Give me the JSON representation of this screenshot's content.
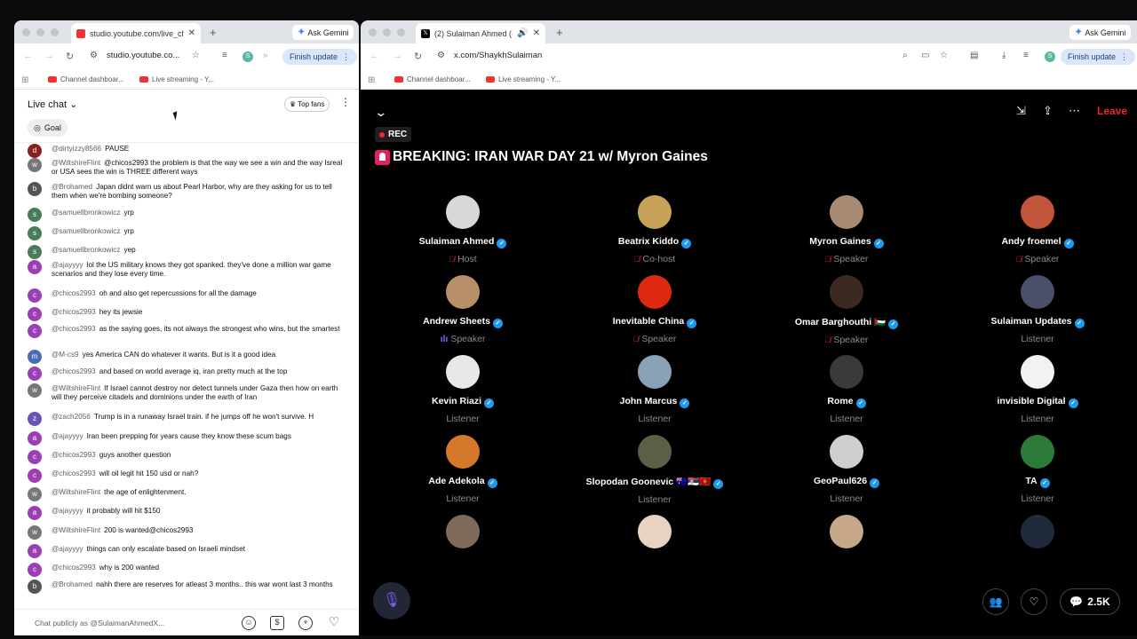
{
  "left_browser": {
    "tab_title": "studio.youtube.com/live_cha",
    "ask_gemini": "Ask Gemini",
    "url": "studio.youtube.co...",
    "finish_update": "Finish update",
    "bookmarks": [
      "Channel dashboar...",
      "Live streaming - Y..."
    ]
  },
  "youtube": {
    "live_chat": "Live chat",
    "top_fans": "Top fans",
    "goal": "Goal",
    "messages": [
      {
        "author": "@dirtyizzy8566",
        "text": "PAUSE",
        "color": "#8b1f1f"
      },
      {
        "author": "@WiltshireFlint",
        "text": "@chicos2993 the problem is that the way we see a win and the way Isreal or USA sees the win is THREE different ways",
        "color": "#777777"
      },
      {
        "author": "@Brohamed",
        "text": "Japan didnt warn us about Pearl Harbor, why are they asking for us to tell them when we're bombing someone?",
        "color": "#555555"
      },
      {
        "author": "@samuellbronkowicz",
        "text": "yrp",
        "color": "#4a7c59"
      },
      {
        "author": "@samuellbronkowicz",
        "text": "yrp",
        "color": "#4a7c59"
      },
      {
        "author": "@samuellbronkowicz",
        "text": "yep",
        "color": "#4a7c59"
      },
      {
        "author": "@ajayyyy",
        "text": "lol the US military knows they got spanked. they've done a million war game scenarios and they lose every time.",
        "color": "#9c3fb5"
      },
      {
        "author": "@chicos2993",
        "text": "oh and also get repercussions for all the damage",
        "color": "#9c3fb5"
      },
      {
        "author": "@chicos2993",
        "text": "hey its jewsie",
        "color": "#9c3fb5"
      },
      {
        "author": "@chicos2993",
        "text": "as the saying goes, its not always the strongest who wins, but the smartest",
        "color": "#9c3fb5"
      },
      {
        "author": "@M-cs9",
        "text": "yes America CAN do whatever it wants. But is it a good idea",
        "color": "#4a6bb5"
      },
      {
        "author": "@chicos2993",
        "text": "and based on world average iq, iran pretty much at the top",
        "color": "#9c3fb5"
      },
      {
        "author": "@WiltshireFlint",
        "text": "If Israel cannot destroy nor detect tunnels under Gaza then how on earth will they perceive citadels and dominions under the earth of Iran",
        "color": "#777777"
      },
      {
        "author": "@zach2056",
        "text": "Trump is in a runaway Israel train. if he jumps off he won't survive. H",
        "color": "#6a55b5"
      },
      {
        "author": "@ajayyyy",
        "text": "Iran been prepping for years cause they know these scum bags",
        "color": "#9c3fb5"
      },
      {
        "author": "@chicos2993",
        "text": "guys another question",
        "color": "#9c3fb5"
      },
      {
        "author": "@chicos2993",
        "text": "will oil legit hit 150 usd or nah?",
        "color": "#9c3fb5"
      },
      {
        "author": "@WiltshireFlint",
        "text": "the age of enlightenment.",
        "color": "#777777"
      },
      {
        "author": "@ajayyyy",
        "text": "it probably will hit $150",
        "color": "#9c3fb5"
      },
      {
        "author": "@WiltshireFlint",
        "text": "200 is wanted@chicos2993",
        "color": "#777777"
      },
      {
        "author": "@ajayyyy",
        "text": "things can only escalate based on Israeli mindset",
        "color": "#9c3fb5"
      },
      {
        "author": "@chicos2993",
        "text": "why is 200 wanted",
        "color": "#9c3fb5"
      },
      {
        "author": "@Brohamed",
        "text": "nahh there are reserves for atleast 3 months.. this war wont last 3 months",
        "color": "#555555"
      }
    ],
    "chat_placeholder": "Chat publicly as @SulaimanAhmedX..."
  },
  "right_browser": {
    "tab_title": "(2) Sulaiman Ahmed (@S",
    "ask_gemini": "Ask Gemini",
    "url": "x.com/ShaykhSulaiman",
    "finish_update": "Finish update",
    "bookmarks": [
      "Channel dashboar...",
      "Live streaming - Y..."
    ]
  },
  "space": {
    "leave": "Leave",
    "rec": "REC",
    "title": "BREAKING: IRAN WAR DAY 21 w/ Myron Gaines",
    "participants": [
      {
        "name": "Sulaiman Ahmed",
        "role": "Host",
        "verified": true,
        "muted": true,
        "color": "#d8d8d8"
      },
      {
        "name": "Beatrix Kiddo",
        "role": "Co-host",
        "verified": true,
        "muted": true,
        "color": "#c9a25a"
      },
      {
        "name": "Myron Gaines",
        "role": "Speaker",
        "verified": true,
        "muted": true,
        "color": "#a78a74"
      },
      {
        "name": "Andy froemel",
        "role": "Speaker",
        "verified": true,
        "muted": true,
        "color": "#c0553a"
      },
      {
        "name": "Andrew Sheets",
        "role": "Speaker",
        "verified": true,
        "muted": false,
        "speaking": true,
        "color": "#b98f6a"
      },
      {
        "name": "Inevitable China",
        "role": "Speaker",
        "verified": true,
        "muted": true,
        "color": "#de2910"
      },
      {
        "name": "Omar Barghouthi 🇵🇸",
        "role": "Speaker",
        "verified": true,
        "muted": true,
        "color": "#3a2a22"
      },
      {
        "name": "Sulaiman Updates",
        "role": "Listener",
        "verified": true,
        "muted": false,
        "color": "#4a4f6a"
      },
      {
        "name": "Kevin Riazi",
        "role": "Listener",
        "verified": true,
        "muted": false,
        "color": "#e8e8e8"
      },
      {
        "name": "John Marcus",
        "role": "Listener",
        "verified": true,
        "muted": false,
        "color": "#8aa2b8"
      },
      {
        "name": "Rome",
        "role": "Listener",
        "verified": true,
        "muted": false,
        "color": "#3a3a3a"
      },
      {
        "name": "invisible Digital",
        "role": "Listener",
        "verified": true,
        "muted": false,
        "color": "#f2f2f2"
      },
      {
        "name": "Ade Adekola",
        "role": "Listener",
        "verified": true,
        "muted": false,
        "color": "#d4782a"
      },
      {
        "name": "Slopodan Goonevic 🇦🇺🇷🇸🇲🇪",
        "role": "Listener",
        "verified": true,
        "muted": false,
        "color": "#5b5f45"
      },
      {
        "name": "GeoPaul626",
        "role": "Listener",
        "verified": true,
        "muted": false,
        "color": "#cfcfcf"
      },
      {
        "name": "TA",
        "role": "Listener",
        "verified": true,
        "muted": false,
        "color": "#2d7a3a"
      },
      {
        "name": "",
        "role": "",
        "verified": false,
        "muted": false,
        "color": "#7d6a5a"
      },
      {
        "name": "",
        "role": "",
        "verified": false,
        "muted": false,
        "color": "#e6d3c4"
      },
      {
        "name": "",
        "role": "",
        "verified": false,
        "muted": false,
        "color": "#c7a889"
      },
      {
        "name": "",
        "role": "",
        "verified": false,
        "muted": false,
        "color": "#1f2a3a"
      }
    ],
    "reply_count": "2.5K"
  }
}
